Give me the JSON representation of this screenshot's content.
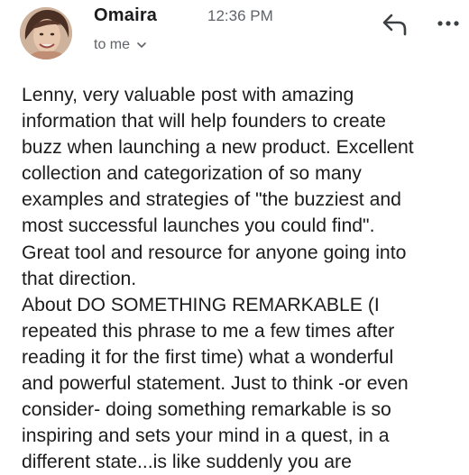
{
  "email": {
    "sender": "Omaira",
    "time": "12:36 PM",
    "recipient": "to me",
    "icons": {
      "avatar": "sender-avatar",
      "reply": "reply-icon",
      "more": "more-options-icon",
      "chevron": "chevron-down-icon"
    },
    "body_lines": [
      "Lenny, very valuable post with amazing",
      "information that will help founders to create",
      "buzz when launching a new product. Excellent",
      "collection and categorization of so many",
      "examples and strategies of  \"the buzziest and",
      "most successful launches you could find\".",
      "Great tool and resource for anyone going into",
      "that direction.",
      "About DO SOMETHING REMARKABLE  (I",
      "repeated this phrase to me a few times after",
      "reading it for the first time) what a wonderful",
      "and powerful statement. Just to think -or even",
      "consider- doing something remarkable is so",
      "inspiring and sets your mind in a quest, in a",
      "different state...is like suddenly you are"
    ]
  },
  "colors": {
    "text": "#1c1c1e",
    "secondary_text": "#5f6368",
    "background": "#ffffff"
  }
}
